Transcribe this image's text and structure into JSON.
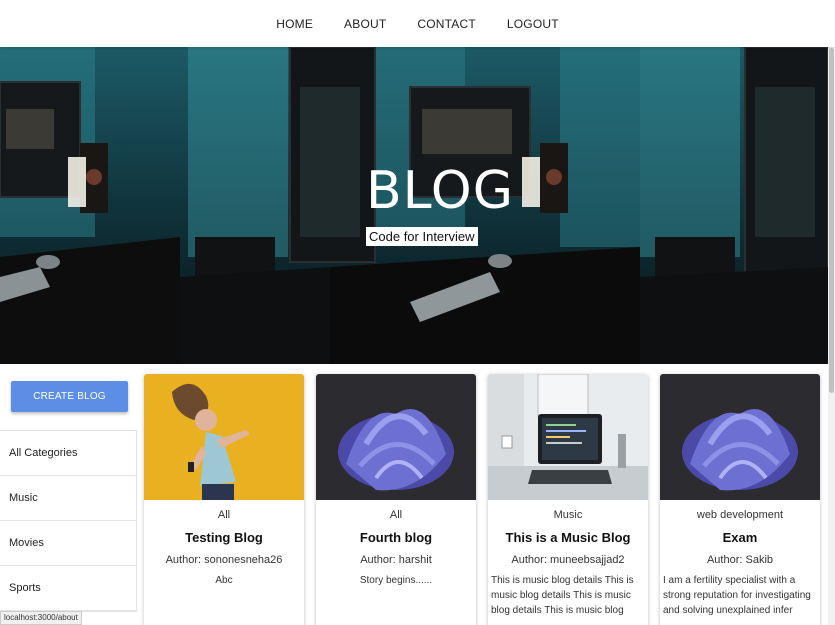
{
  "nav": {
    "items": [
      "HOME",
      "ABOUT",
      "CONTACT",
      "LOGOUT"
    ]
  },
  "banner": {
    "title": "BLOG",
    "subtitle": "Code for Interview"
  },
  "sidebar": {
    "create_label": "CREATE BLOG",
    "categories": [
      "All Categories",
      "Music",
      "Movies",
      "Sports"
    ]
  },
  "posts": [
    {
      "category": "All",
      "title": "Testing Blog",
      "author": "Author: sononesneha26",
      "desc": "Abc"
    },
    {
      "category": "All",
      "title": "Fourth blog",
      "author": "Author: harshit",
      "desc": "Story begins......"
    },
    {
      "category": "Music",
      "title": "This is a Music Blog",
      "author": "Author: muneebsajjad2",
      "desc": "This is music blog details This is music blog details This is music blog details This is music blog"
    },
    {
      "category": "web development",
      "title": "Exam",
      "author": "Author: Sakib",
      "desc": "I am a fertility specialist with a strong reputation for investigating and solving unexplained infer"
    }
  ],
  "status_url": "localhost:3000/about",
  "colors": {
    "accent": "#5c8ee6",
    "banner_dark": "#0b1e24",
    "card_yellow": "#e9b021",
    "shape_purple": "#6d6fd1"
  }
}
